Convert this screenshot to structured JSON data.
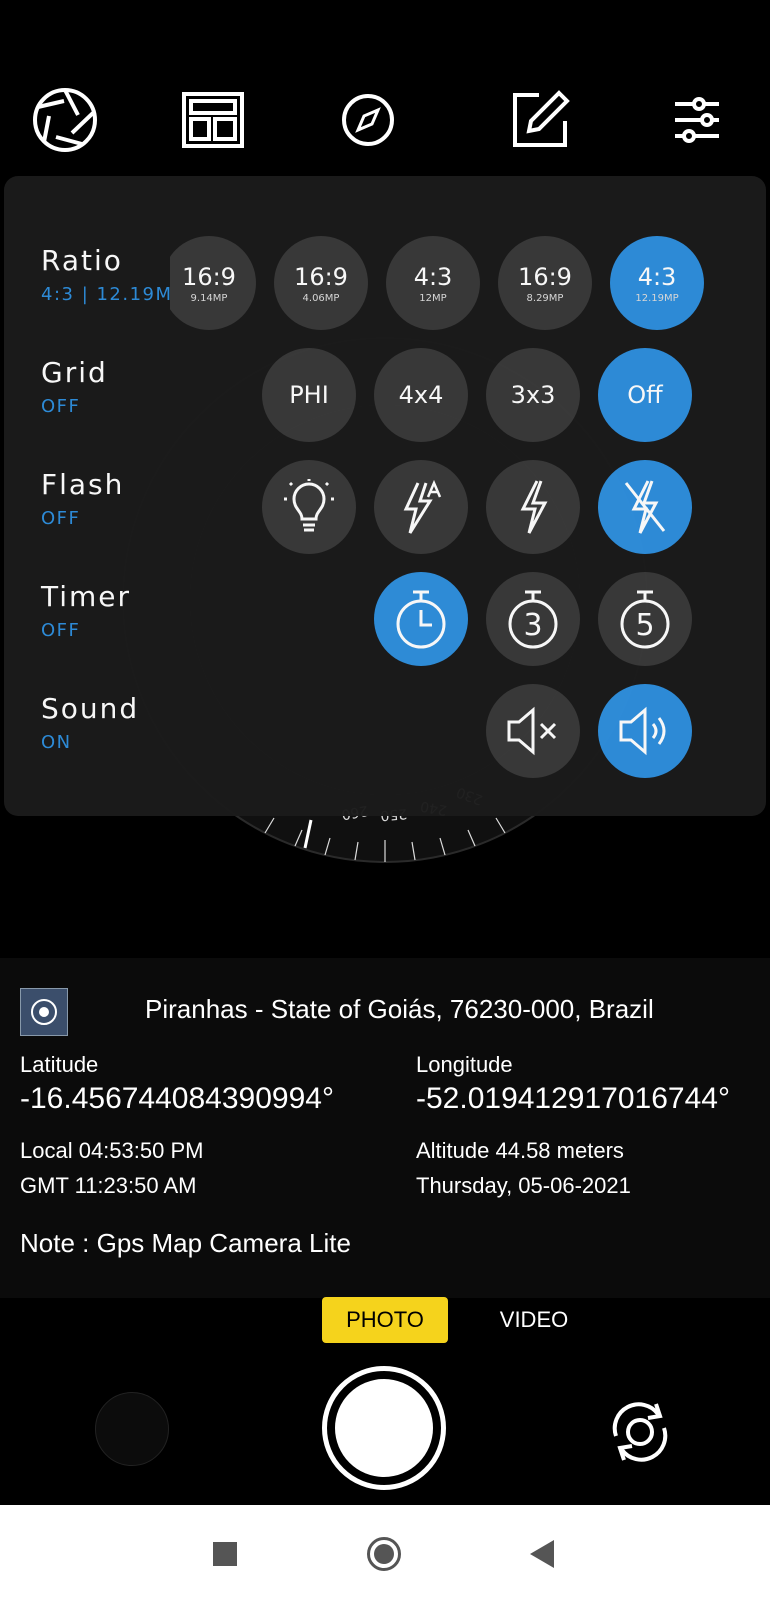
{
  "toolbar": {
    "icons": [
      "aperture-icon",
      "layout-icon",
      "compass-icon",
      "edit-icon",
      "sliders-icon"
    ]
  },
  "compass": {
    "tick_labels": [
      "260",
      "250",
      "240",
      "230"
    ]
  },
  "settings": {
    "ratio": {
      "title": "Ratio",
      "value": "4:3 | 12.19MP",
      "options": [
        {
          "label": "16:9",
          "sub": "9.14MP"
        },
        {
          "label": "16:9",
          "sub": "4.06MP"
        },
        {
          "label": "4:3",
          "sub": "12MP"
        },
        {
          "label": "16:9",
          "sub": "8.29MP"
        },
        {
          "label": "4:3",
          "sub": "12.19MP"
        }
      ]
    },
    "grid": {
      "title": "Grid",
      "value": "OFF",
      "options": [
        "PHI",
        "4x4",
        "3x3",
        "Off"
      ]
    },
    "flash": {
      "title": "Flash",
      "value": "OFF",
      "options": [
        "torch-icon",
        "flash-auto-icon",
        "flash-on-icon",
        "flash-off-icon"
      ]
    },
    "timer": {
      "title": "Timer",
      "value": "OFF",
      "options": [
        "timer-off-icon",
        "timer-3-icon",
        "timer-5-icon"
      ],
      "timer_3_digit": "3",
      "timer_5_digit": "5"
    },
    "sound": {
      "title": "Sound",
      "value": "ON",
      "options": [
        "sound-mute-icon",
        "sound-on-icon"
      ]
    }
  },
  "location": {
    "address": "Piranhas - State of Goiás, 76230-000, Brazil",
    "latitude_label": "Latitude",
    "latitude": "-16.456744084390994°",
    "longitude_label": "Longitude",
    "longitude": "-52.019412917016744°",
    "local_time": "Local 04:53:50 PM",
    "gmt_time": "GMT 11:23:50 AM",
    "altitude": "Altitude 44.58 meters",
    "date": "Thursday, 05-06-2021",
    "note": "Note : Gps Map Camera Lite"
  },
  "modes": {
    "photo": "PHOTO",
    "video": "VIDEO"
  },
  "colors": {
    "accent": "#2f8fdd",
    "mode_highlight": "#f5d31c",
    "panel_bg": "#1b1b1b",
    "option_bg": "#3a3a3a"
  }
}
